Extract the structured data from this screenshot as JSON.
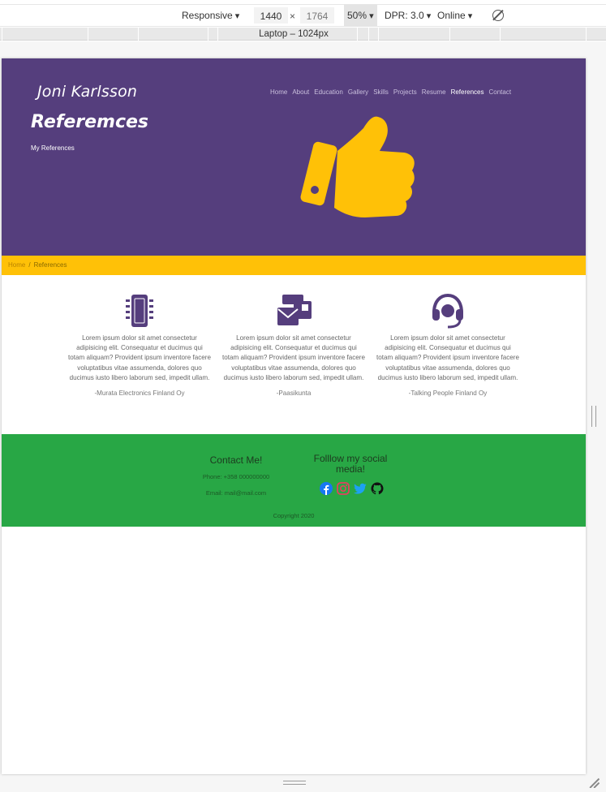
{
  "devtools": {
    "device": "Responsive",
    "width": "1440",
    "height": "1764",
    "zoom": "50%",
    "dpr": "DPR: 3.0",
    "throttling": "Online",
    "media_query_label": "Laptop – 1024px"
  },
  "site": {
    "brand": "Joni Karlsson",
    "nav": [
      "Home",
      "About",
      "Education",
      "Gallery",
      "Skills",
      "Projects",
      "Resume",
      "References",
      "Contact"
    ],
    "nav_active": "References",
    "hero_title": "Referemces",
    "hero_subtitle": "My References",
    "colors": {
      "hero": "#553e7d",
      "accent": "#ffc107",
      "footer": "#28a745"
    }
  },
  "breadcrumb": {
    "home": "Home",
    "separator": "/",
    "current": "References"
  },
  "references": [
    {
      "icon": "microchip-icon",
      "text": "Lorem ipsum dolor sit amet consectetur adipisicing elit. Consequatur et ducimus qui totam aliquam? Provident ipsum inventore facere voluptatibus vitae assumenda, dolores quo ducimus iusto libero laborum sed, impedit ullam.",
      "author": "-Murata Electronics Finland Oy"
    },
    {
      "icon": "mail-bulk-icon",
      "text": "Lorem ipsum dolor sit amet consectetur adipisicing elit. Consequatur et ducimus qui totam aliquam? Provident ipsum inventore facere voluptatibus vitae assumenda, dolores quo ducimus iusto libero laborum sed, impedit ullam.",
      "author": "-Paasikunta"
    },
    {
      "icon": "headset-icon",
      "text": "Lorem ipsum dolor sit amet consectetur adipisicing elit. Consequatur et ducimus qui totam aliquam? Provident ipsum inventore facere voluptatibus vitae assumenda, dolores quo ducimus iusto libero laborum sed, impedit ullam.",
      "author": "-Talking People Finland Oy"
    }
  ],
  "footer": {
    "contact_title": "Contact Me!",
    "phone": "Phone: +358 000000000",
    "email": "Email: mail@mail.com",
    "social_title": "Folllow my social media!",
    "socials": [
      "facebook-icon",
      "instagram-icon",
      "twitter-icon",
      "github-icon"
    ],
    "copyright": "Copyright 2020"
  }
}
